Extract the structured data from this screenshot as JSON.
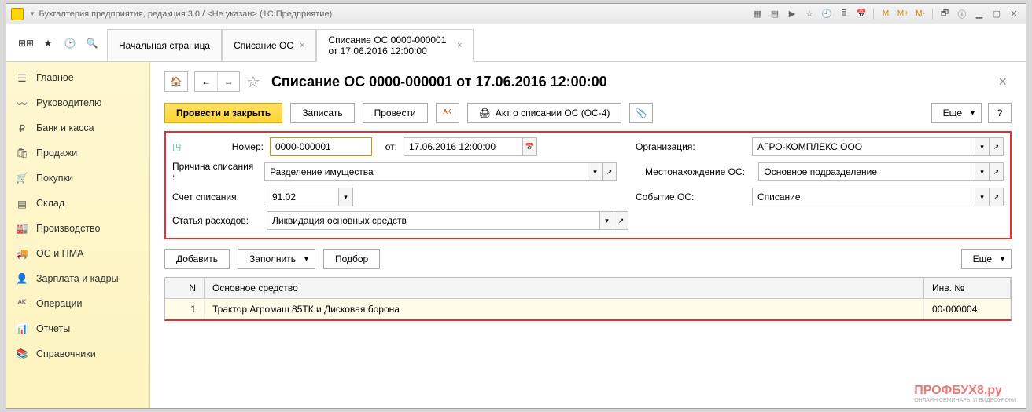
{
  "titlebar": {
    "app_title": "Бухгалтерия предприятия, редакция 3.0 / <Не указан>  (1С:Предприятие)",
    "m_labels": [
      "M",
      "M+",
      "M-"
    ]
  },
  "tabs": {
    "home": "Начальная страница",
    "tab1": "Списание ОС",
    "tab2": "Списание ОС 0000-000001 от 17.06.2016 12:00:00"
  },
  "sidebar": {
    "items": [
      {
        "icon": "menu",
        "label": "Главное"
      },
      {
        "icon": "trend",
        "label": "Руководителю"
      },
      {
        "icon": "ruble",
        "label": "Банк и касса"
      },
      {
        "icon": "bag",
        "label": "Продажи"
      },
      {
        "icon": "cart",
        "label": "Покупки"
      },
      {
        "icon": "boxes",
        "label": "Склад"
      },
      {
        "icon": "factory",
        "label": "Производство"
      },
      {
        "icon": "truck",
        "label": "ОС и НМА"
      },
      {
        "icon": "person",
        "label": "Зарплата и кадры"
      },
      {
        "icon": "ops",
        "label": "Операции"
      },
      {
        "icon": "chart",
        "label": "Отчеты"
      },
      {
        "icon": "book",
        "label": "Справочники"
      }
    ]
  },
  "page": {
    "title": "Списание ОС 0000-000001 от 17.06.2016 12:00:00"
  },
  "toolbar": {
    "primary": "Провести и закрыть",
    "save": "Записать",
    "post": "Провести",
    "act": "Акт о списании ОС (ОС-4)",
    "more": "Еще"
  },
  "form": {
    "number_label": "Номер:",
    "number_value": "0000-000001",
    "ot_label": "от:",
    "date_value": "17.06.2016 12:00:00",
    "org_label": "Организация:",
    "org_value": "АГРО-КОМПЛЕКС ООО",
    "reason_label": "Причина списания :",
    "reason_value": "Разделение имущества",
    "location_label": "Местонахождение ОС:",
    "location_value": "Основное подразделение",
    "account_label": "Счет списания:",
    "account_value": "91.02",
    "event_label": "Событие ОС:",
    "event_value": "Списание",
    "expense_label": "Статья расходов:",
    "expense_value": "Ликвидация основных средств"
  },
  "addrow": {
    "add": "Добавить",
    "fill": "Заполнить",
    "select": "Подбор",
    "more": "Еще"
  },
  "table": {
    "col_n": "N",
    "col_name": "Основное средство",
    "col_inv": "Инв. №",
    "rows": [
      {
        "n": "1",
        "name": "Трактор Агромаш 85ТК и Дисковая борона",
        "inv": "00-000004"
      }
    ]
  },
  "watermark": "ПРОФБУХ8.ру",
  "watermark_sub": "ОНЛАЙН СЕМИНАРЫ И ВИДЕОУРОКИ"
}
